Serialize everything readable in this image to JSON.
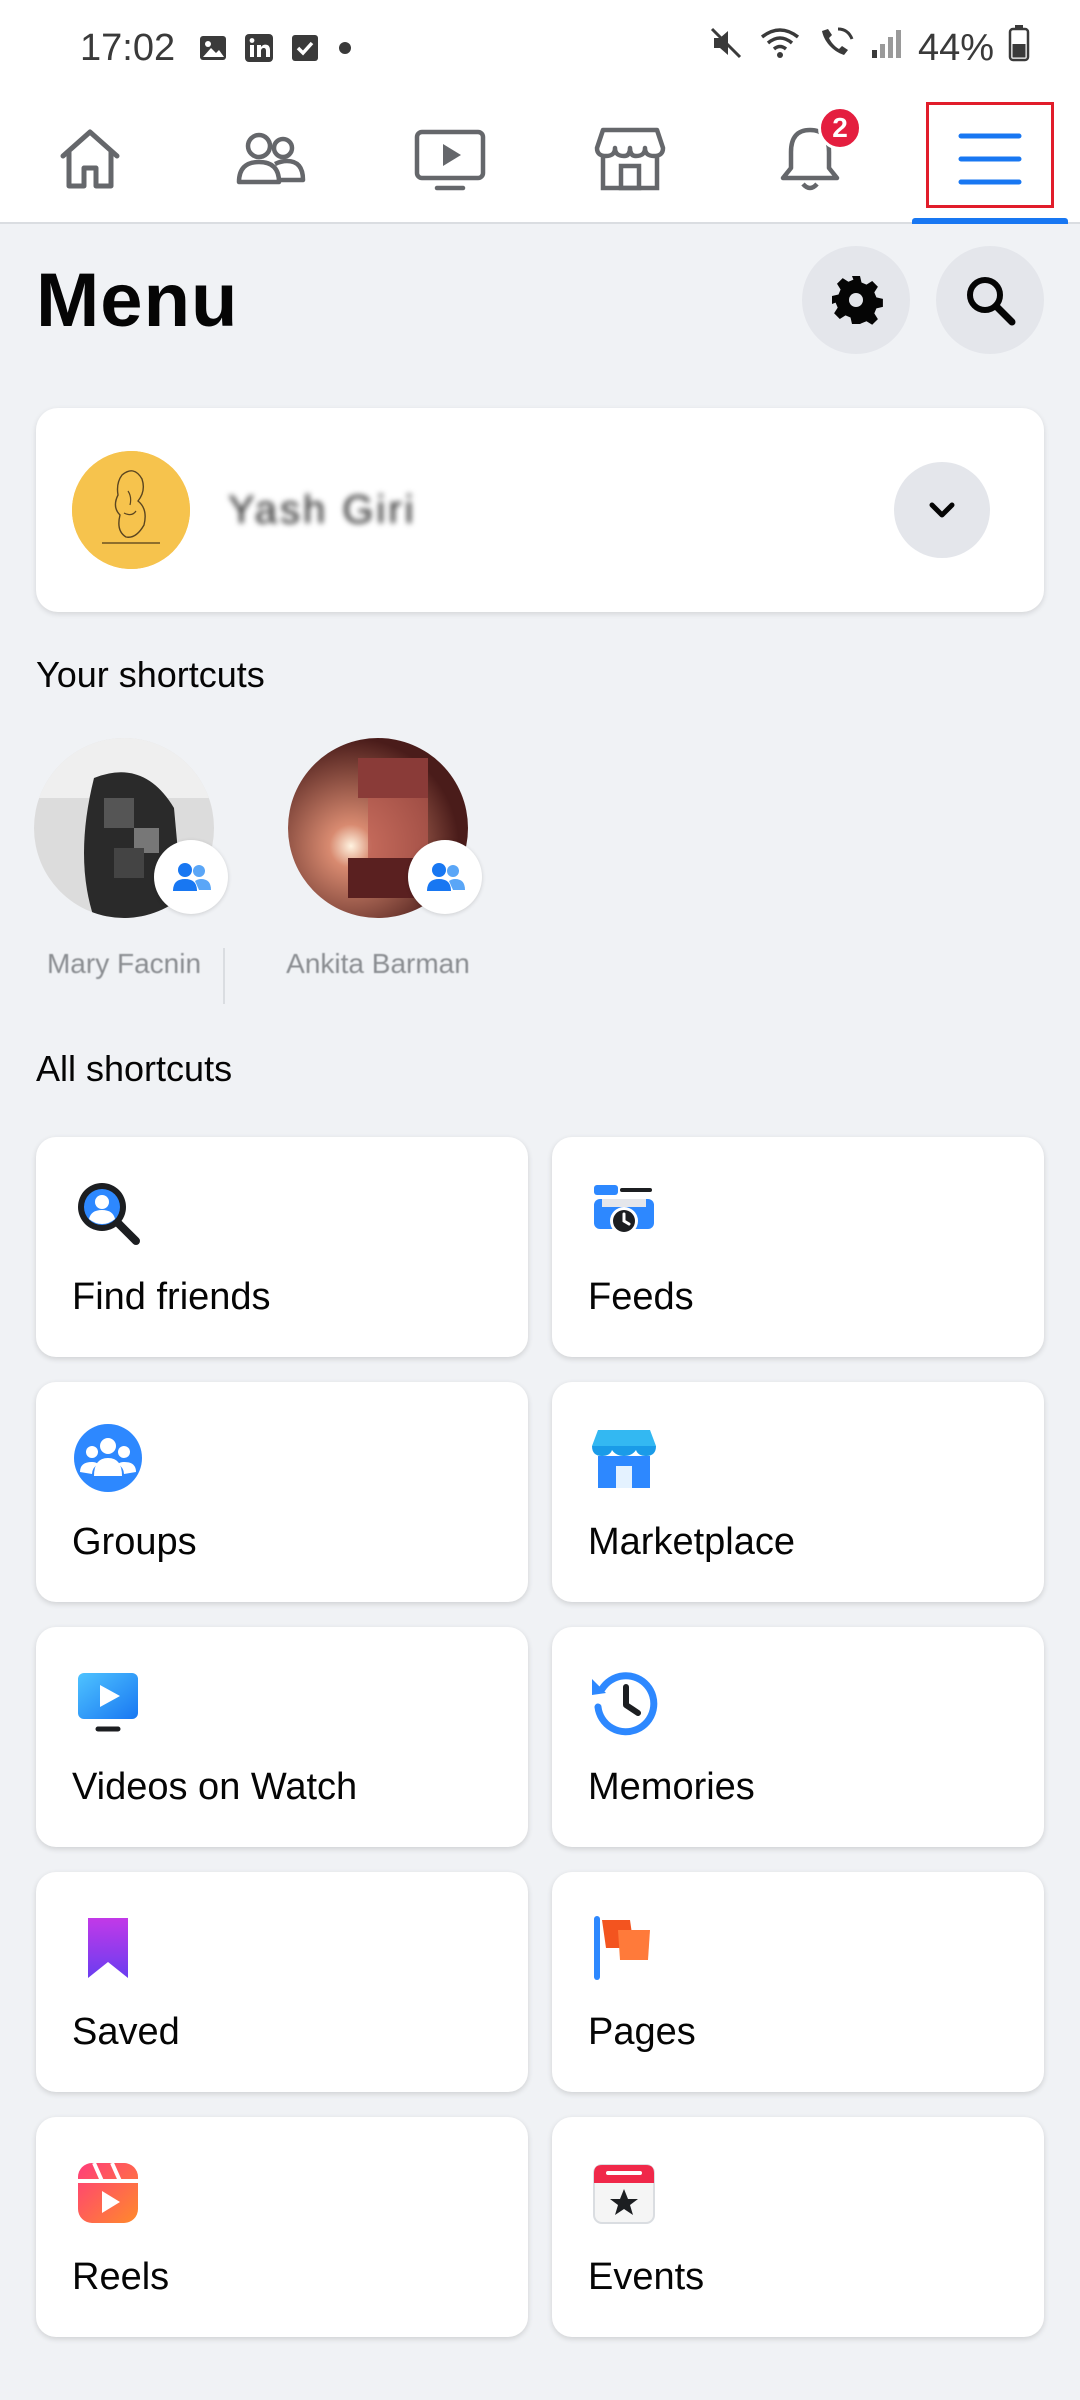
{
  "status_bar": {
    "time": "17:02",
    "battery": "44%"
  },
  "tabs": [
    {
      "name": "home",
      "icon": "home-icon"
    },
    {
      "name": "friends",
      "icon": "friends-icon"
    },
    {
      "name": "watch",
      "icon": "video-icon"
    },
    {
      "name": "marketplace",
      "icon": "store-icon"
    },
    {
      "name": "notifications",
      "icon": "bell-icon",
      "badge": "2"
    },
    {
      "name": "menu",
      "icon": "hamburger-icon",
      "active": true
    }
  ],
  "header": {
    "title": "Menu"
  },
  "profile": {
    "name": "Yash Giri"
  },
  "your_shortcuts": {
    "title": "Your shortcuts",
    "items": [
      {
        "name": "Mary Facnin"
      },
      {
        "name": "Ankita Barman"
      }
    ]
  },
  "all_shortcuts": {
    "title": "All shortcuts",
    "items": [
      {
        "label": "Find friends",
        "icon": "find-friends-icon"
      },
      {
        "label": "Feeds",
        "icon": "feeds-icon"
      },
      {
        "label": "Groups",
        "icon": "groups-icon"
      },
      {
        "label": "Marketplace",
        "icon": "marketplace-icon"
      },
      {
        "label": "Videos on Watch",
        "icon": "watch-icon"
      },
      {
        "label": "Memories",
        "icon": "memories-icon"
      },
      {
        "label": "Saved",
        "icon": "bookmark-icon"
      },
      {
        "label": "Pages",
        "icon": "flag-icon"
      },
      {
        "label": "Reels",
        "icon": "reels-icon"
      },
      {
        "label": "Events",
        "icon": "calendar-icon"
      }
    ]
  },
  "colors": {
    "accent": "#1877f2",
    "highlight": "#e11d2a",
    "badge": "#e41e3f",
    "background": "#f0f2f5"
  }
}
